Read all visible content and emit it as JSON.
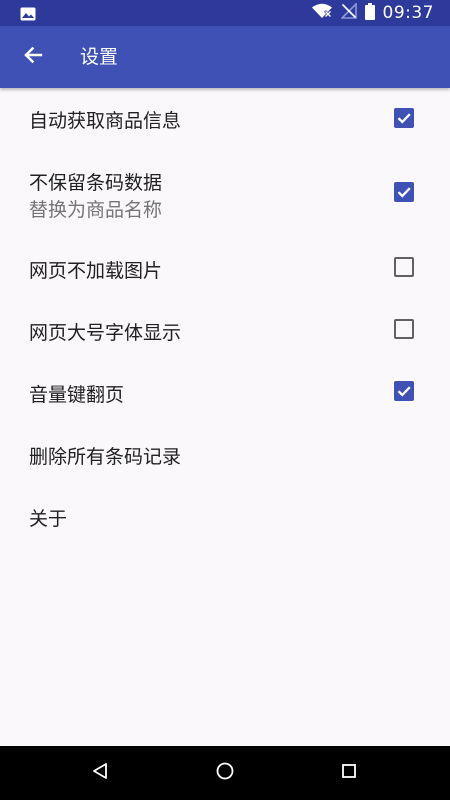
{
  "status_bar": {
    "time": "09:37",
    "icons": [
      "image-icon",
      "wifi-icon",
      "no-signal-icon",
      "battery-icon"
    ]
  },
  "toolbar": {
    "back_icon": "arrow-back-icon",
    "title": "设置"
  },
  "settings": [
    {
      "title": "自动获取商品信息",
      "subtitle": "",
      "checked": true
    },
    {
      "title": "不保留条码数据",
      "subtitle": "替换为商品名称",
      "checked": true
    },
    {
      "title": "网页不加载图片",
      "subtitle": "",
      "checked": false
    },
    {
      "title": "网页大号字体显示",
      "subtitle": "",
      "checked": false
    },
    {
      "title": "音量键翻页",
      "subtitle": "",
      "checked": true
    },
    {
      "title": "删除所有条码记录"
    },
    {
      "title": "关于"
    }
  ],
  "nav_bar": {
    "icons": [
      "back-triangle-icon",
      "home-circle-icon",
      "recents-square-icon"
    ]
  },
  "colors": {
    "status_bar": "#2d3a9c",
    "toolbar": "#3f51b5",
    "checkbox_checked": "#3f51b5",
    "background": "#faf8fb",
    "nav_bar": "#000000"
  }
}
